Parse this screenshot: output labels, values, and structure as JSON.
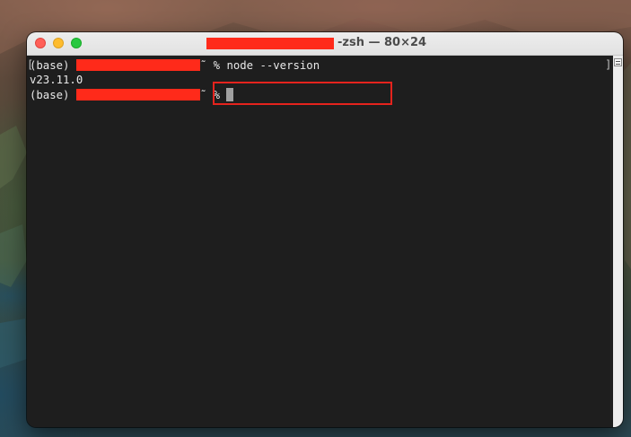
{
  "window": {
    "title_suffix": "-zsh — 80×24"
  },
  "terminal": {
    "lines": [
      {
        "env_prefix": "(base) ",
        "prompt_symbol": "% ",
        "command": "node --version"
      },
      {
        "output": "v23.11.0"
      },
      {
        "env_prefix": "(base) ",
        "prompt_symbol": "% ",
        "command": ""
      }
    ]
  },
  "colors": {
    "redaction": "#ff2a1a",
    "highlight_box": "#e5231d",
    "terminal_bg": "#1e1e1e"
  },
  "icons": {
    "window_controls": [
      "close-button",
      "minimize-button",
      "zoom-button"
    ],
    "scroll_indicator": "scroll-marker-icon"
  }
}
